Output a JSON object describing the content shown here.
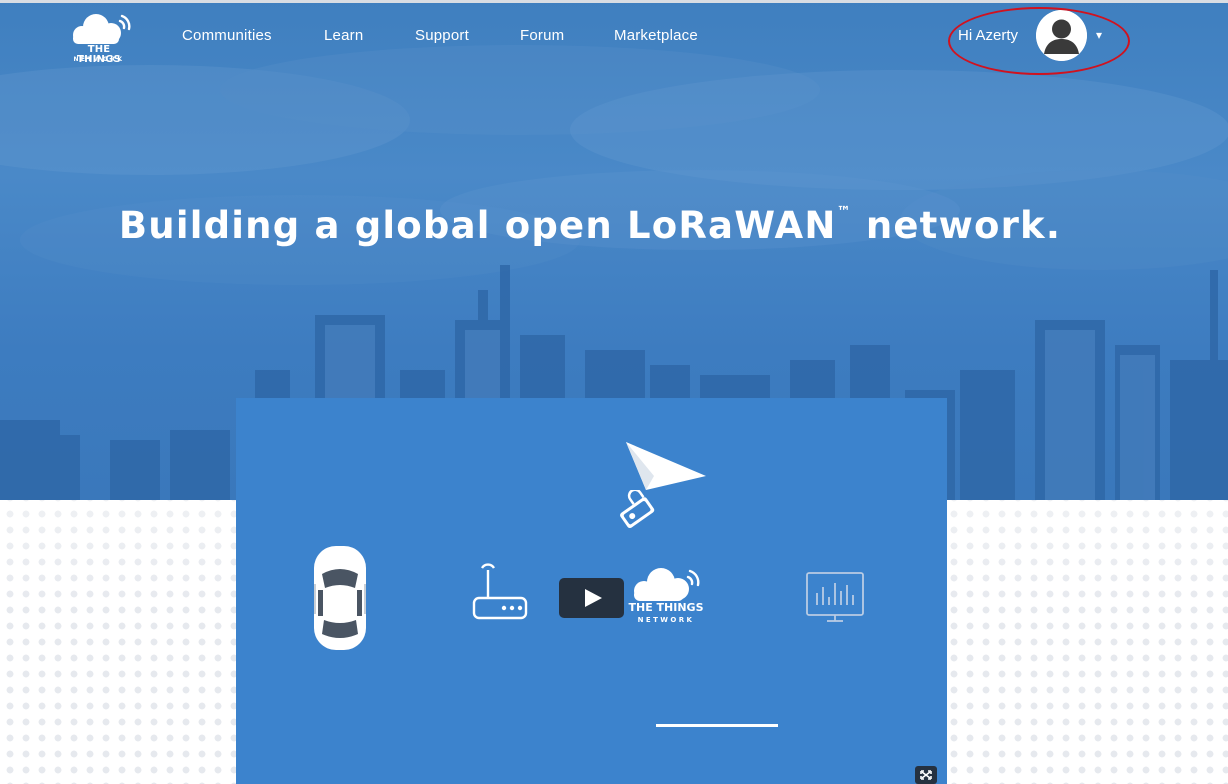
{
  "brand": {
    "logo_line1": "THE THINGS",
    "logo_line2": "NETWORK"
  },
  "nav": {
    "links": [
      "Communities",
      "Learn",
      "Support",
      "Forum",
      "Marketplace"
    ]
  },
  "user": {
    "greeting": "Hi Azerty",
    "caret": "▾"
  },
  "hero": {
    "headline": "Building a global open LoRaWAN",
    "trademark": "™",
    "headline_end": " network."
  },
  "video": {
    "brand_line1": "THE THINGS",
    "brand_line2": "NETWORK",
    "progress": 1.0
  },
  "colors": {
    "hero_blue": "#3d7cc0",
    "video_blue": "#3c83cd",
    "play_button": "#253140",
    "annotation_red": "#d0121f"
  },
  "icons": [
    "cloud-signal-icon",
    "avatar-icon",
    "car-icon",
    "gateway-router-icon",
    "paper-plane-icon",
    "lock-tag-icon",
    "cloud-logo-icon",
    "dashboard-chart-icon",
    "play-icon",
    "fullscreen-icon"
  ]
}
